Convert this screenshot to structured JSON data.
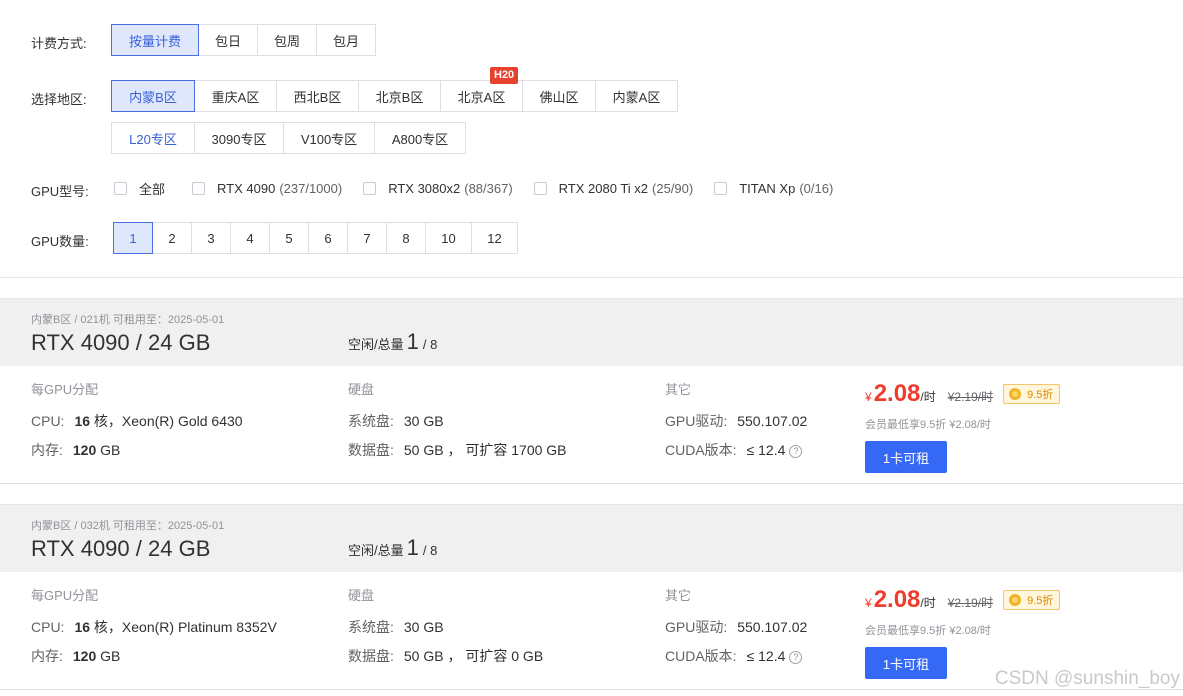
{
  "filters": {
    "billing": {
      "label": "计费方式:",
      "options": [
        "按量计费",
        "包日",
        "包周",
        "包月"
      ]
    },
    "region": {
      "label": "选择地区:",
      "row1": [
        "内蒙B区",
        "重庆A区",
        "西北B区",
        "北京B区",
        "北京A区",
        "佛山区",
        "内蒙A区"
      ],
      "row2": [
        "L20专区",
        "3090专区",
        "V100专区",
        "A800专区"
      ],
      "badge": "H20"
    },
    "gpu_model": {
      "label": "GPU型号:",
      "options": [
        {
          "name": "全部",
          "count": ""
        },
        {
          "name": "RTX 4090",
          "count": "(237/1000)"
        },
        {
          "name": "RTX 3080x2",
          "count": "(88/367)"
        },
        {
          "name": "RTX 2080 Ti x2",
          "count": "(25/90)"
        },
        {
          "name": "TITAN Xp",
          "count": "(0/16)"
        }
      ]
    },
    "gpu_count": {
      "label": "GPU数量:",
      "options": [
        "1",
        "2",
        "3",
        "4",
        "5",
        "6",
        "7",
        "8",
        "10",
        "12"
      ]
    }
  },
  "cards": [
    {
      "meta": "内蒙B区 / 021机   可租用至：2025-05-01",
      "title": "RTX 4090 / 24 GB",
      "avail_label": "空闲/总量",
      "avail_free": "1",
      "avail_total": "/ 8",
      "col1_head": "每GPU分配",
      "cpu_key": "CPU:",
      "cpu_cores": "16",
      "cpu_rest": "核，Xeon(R) Gold 6430",
      "mem_key": "内存:",
      "mem_val": "120",
      "mem_unit": "GB",
      "col2_head": "硬盘",
      "sys_key": "系统盘:",
      "sys_val": "30 GB",
      "data_key": "数据盘:",
      "data_val": "50 GB ， 可扩容 1700 GB",
      "col3_head": "其它",
      "drv_key": "GPU驱动:",
      "drv_val": "550.107.02",
      "cuda_key": "CUDA版本:",
      "cuda_val": "≤ 12.4",
      "yen": "¥",
      "price": "2.08",
      "unit": "/时",
      "orig": "¥2.19/时",
      "discount": "9.5折",
      "member": "会员最低享9.5折 ¥2.08/时",
      "button": "1卡可租"
    },
    {
      "meta": "内蒙B区 / 032机   可租用至：2025-05-01",
      "title": "RTX 4090 / 24 GB",
      "avail_label": "空闲/总量",
      "avail_free": "1",
      "avail_total": "/ 8",
      "col1_head": "每GPU分配",
      "cpu_key": "CPU:",
      "cpu_cores": "16",
      "cpu_rest": "核，Xeon(R) Platinum 8352V",
      "mem_key": "内存:",
      "mem_val": "120",
      "mem_unit": "GB",
      "col2_head": "硬盘",
      "sys_key": "系统盘:",
      "sys_val": "30 GB",
      "data_key": "数据盘:",
      "data_val": "50 GB ， 可扩容 0 GB",
      "col3_head": "其它",
      "drv_key": "GPU驱动:",
      "drv_val": "550.107.02",
      "cuda_key": "CUDA版本:",
      "cuda_val": "≤ 12.4",
      "yen": "¥",
      "price": "2.08",
      "unit": "/时",
      "orig": "¥2.19/时",
      "discount": "9.5折",
      "member": "会员最低享9.5折 ¥2.08/时",
      "button": "1卡可租"
    }
  ],
  "watermark": "CSDN @sunshin_boy"
}
